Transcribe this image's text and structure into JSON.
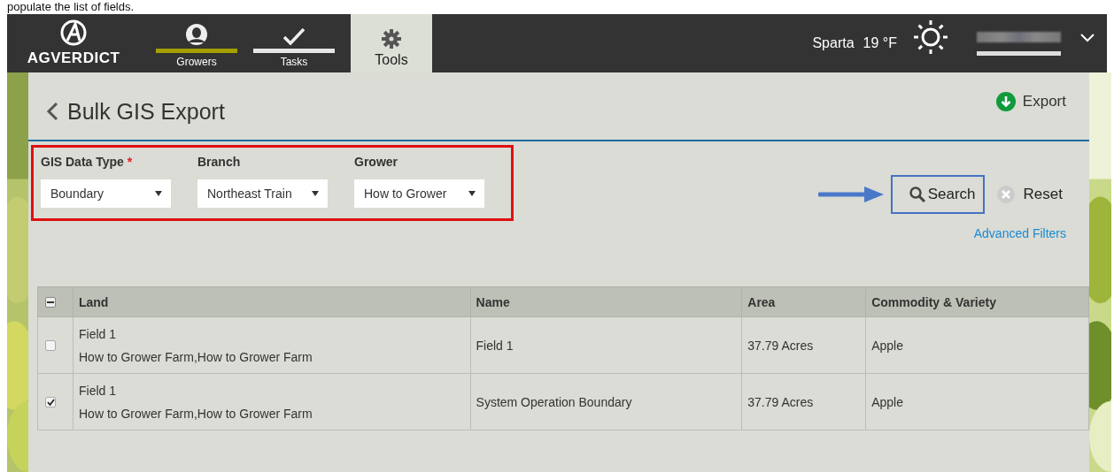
{
  "caption": "populate the list of fields.",
  "nav": {
    "logo": "AGVERDICT",
    "tabs": [
      {
        "label": "Growers",
        "selected": false,
        "color": "#a3a000"
      },
      {
        "label": "Tasks",
        "selected": false,
        "color": "#e6e6e6"
      },
      {
        "label": "Tools",
        "selected": true
      }
    ],
    "location": "Sparta",
    "temperature": "19 °F"
  },
  "page": {
    "title": "Bulk GIS Export",
    "export": "Export"
  },
  "filters": {
    "highlighted": true,
    "fields": [
      {
        "label": "GIS Data Type",
        "required_mark": "*",
        "value": "Boundary"
      },
      {
        "label": "Branch",
        "value": "Northeast Train"
      },
      {
        "label": "Grower",
        "value": "How to Grower"
      }
    ]
  },
  "search": {
    "label": "Search",
    "highlighted": true
  },
  "reset": {
    "label": "Reset"
  },
  "advanced_filters": "Advanced Filters",
  "table": {
    "select_all_indeterminate": true,
    "columns": [
      "Land",
      "Name",
      "Area",
      "Commodity & Variety"
    ],
    "rows": [
      {
        "checked": false,
        "land": [
          "Field 1",
          "How to Grower Farm,How to Grower Farm"
        ],
        "name": "Field 1",
        "area": "37.79 Acres",
        "commodity": "Apple"
      },
      {
        "checked": true,
        "land": [
          "Field 1",
          "How to Grower Farm,How to Grower Farm"
        ],
        "name": "System Operation Boundary",
        "area": "37.79 Acres",
        "commodity": "Apple"
      }
    ]
  }
}
